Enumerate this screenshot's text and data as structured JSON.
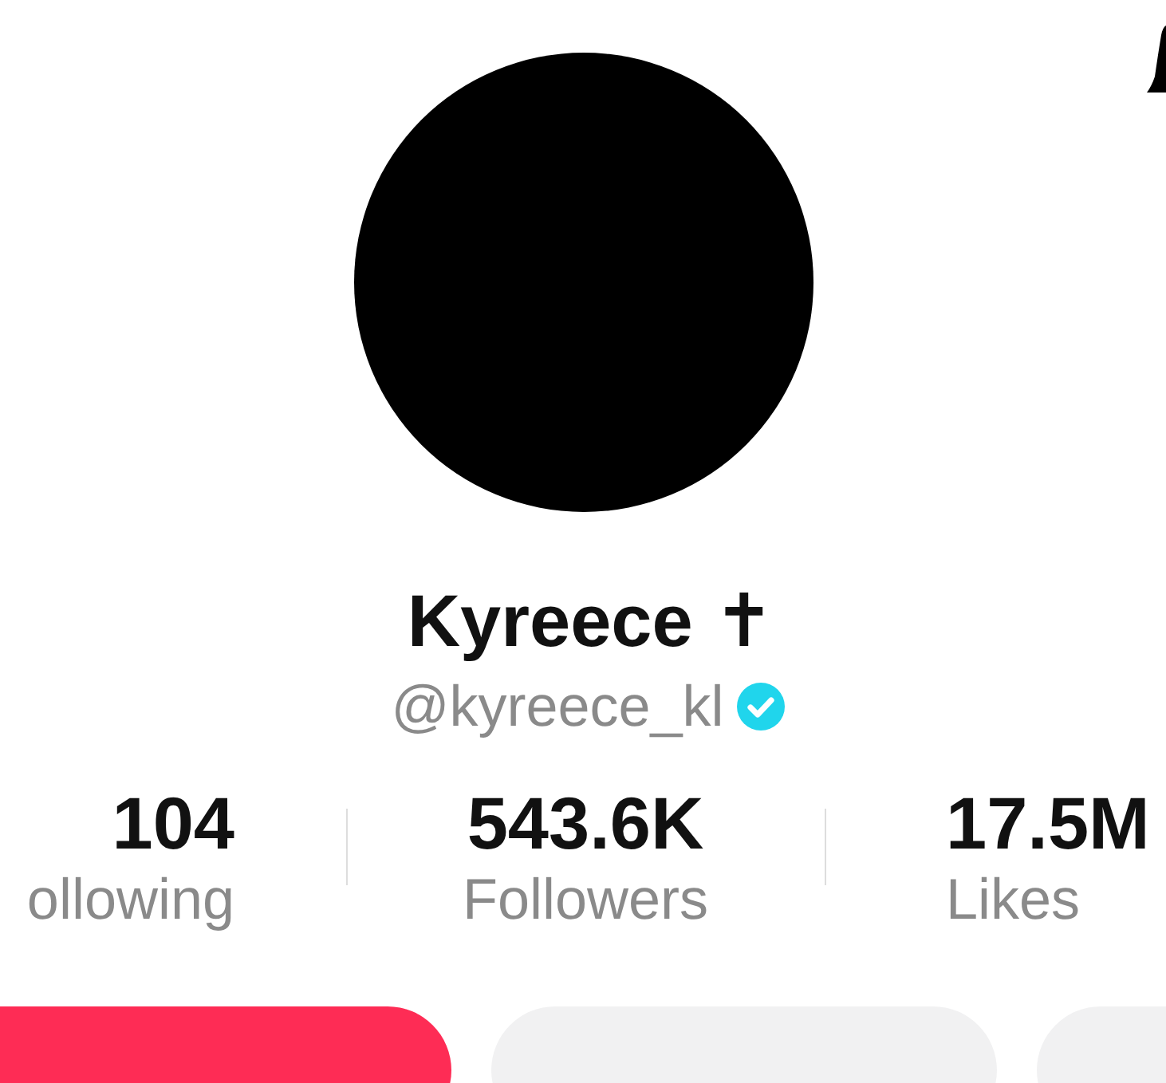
{
  "profile": {
    "name": "Kyreece ✝",
    "handle": "@kyreece_kl",
    "verified": true
  },
  "stats": [
    {
      "value": "104",
      "label": "ollowing"
    },
    {
      "value": "543.6K",
      "label": "Followers"
    },
    {
      "value": "17.5M",
      "label": "Likes"
    }
  ],
  "buttons": [
    {
      "kind": "primary"
    },
    {
      "kind": "secondary"
    },
    {
      "kind": "secondary"
    }
  ]
}
